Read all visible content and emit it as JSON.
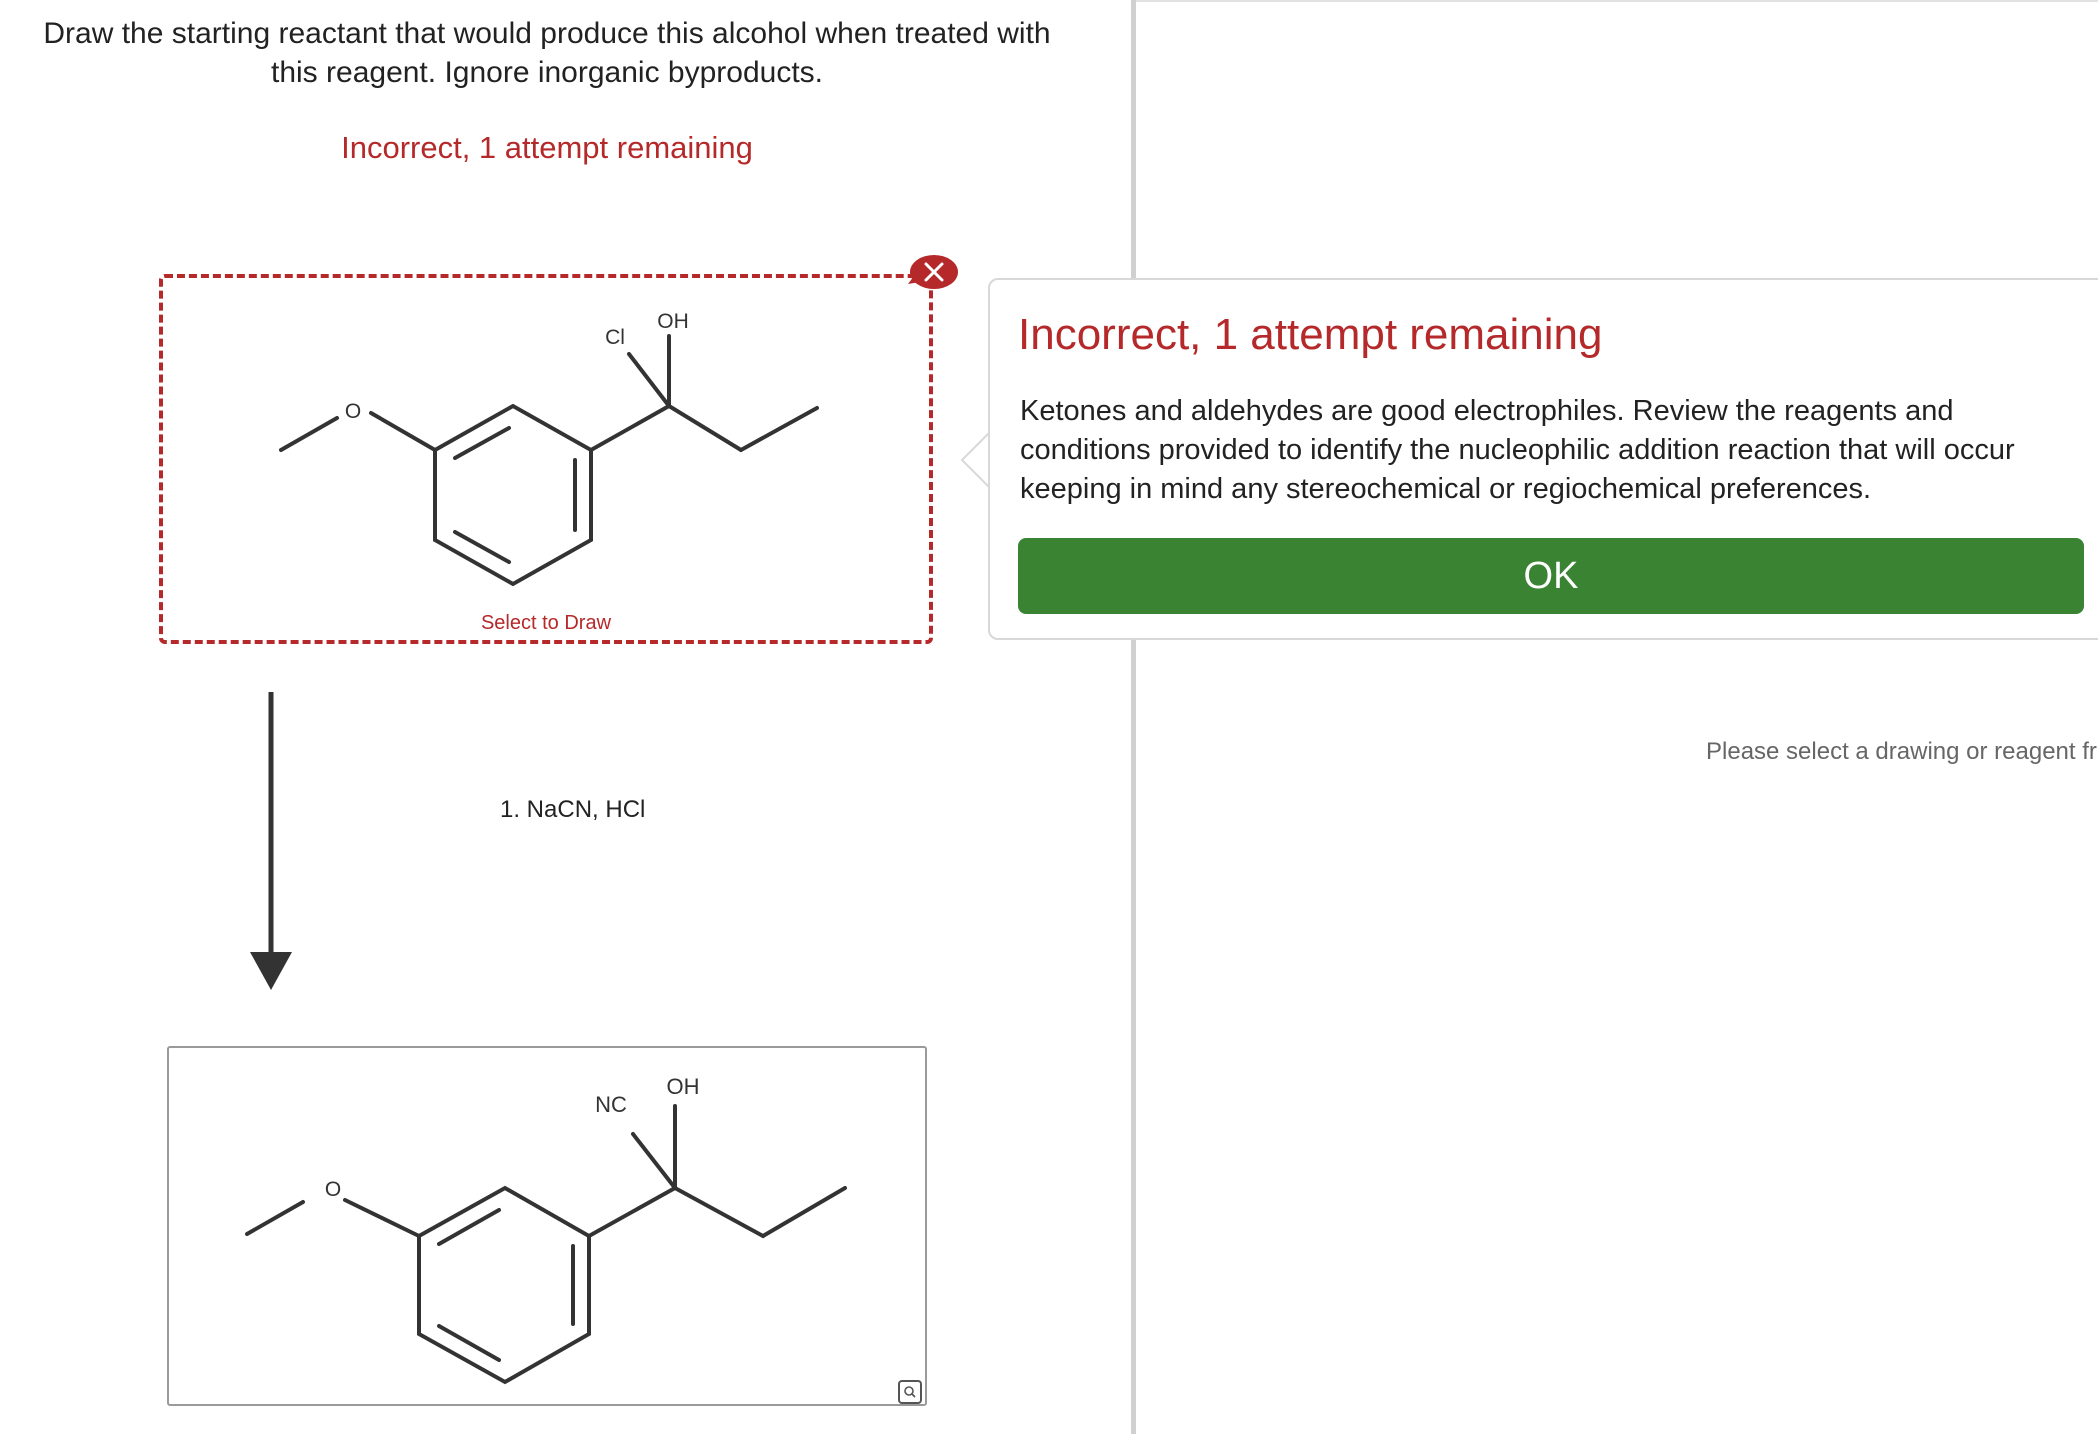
{
  "question": {
    "line1": "Draw the starting reactant that would produce this alcohol when treated with",
    "line2": "this reagent. Ignore inorganic byproducts."
  },
  "status_top": "Incorrect, 1 attempt remaining",
  "reactant_box": {
    "select_label": "Select to Draw",
    "atoms": {
      "oxygen": "O",
      "chlorine": "Cl",
      "hydroxyl": "OH"
    }
  },
  "reagent": "1. NaCN, HCl",
  "product_box": {
    "atoms": {
      "oxygen": "O",
      "nitrile": "NC",
      "hydroxyl": "OH"
    }
  },
  "popover": {
    "title": "Incorrect, 1 attempt remaining",
    "body": "Ketones and aldehydes are good electrophiles. Review the reagents and conditions provided to identify the nucleophilic addition reaction that will occur keeping in mind any stereochemical or regiochemical preferences.",
    "ok_label": "OK"
  },
  "side_hint": "Please select a drawing or reagent fr",
  "colors": {
    "error": "#b5292a",
    "ok_button": "#3a8333",
    "bond": "#333333"
  },
  "icons": {
    "remove": "close-icon",
    "zoom": "magnifier-icon",
    "arrow": "reaction-arrow"
  }
}
